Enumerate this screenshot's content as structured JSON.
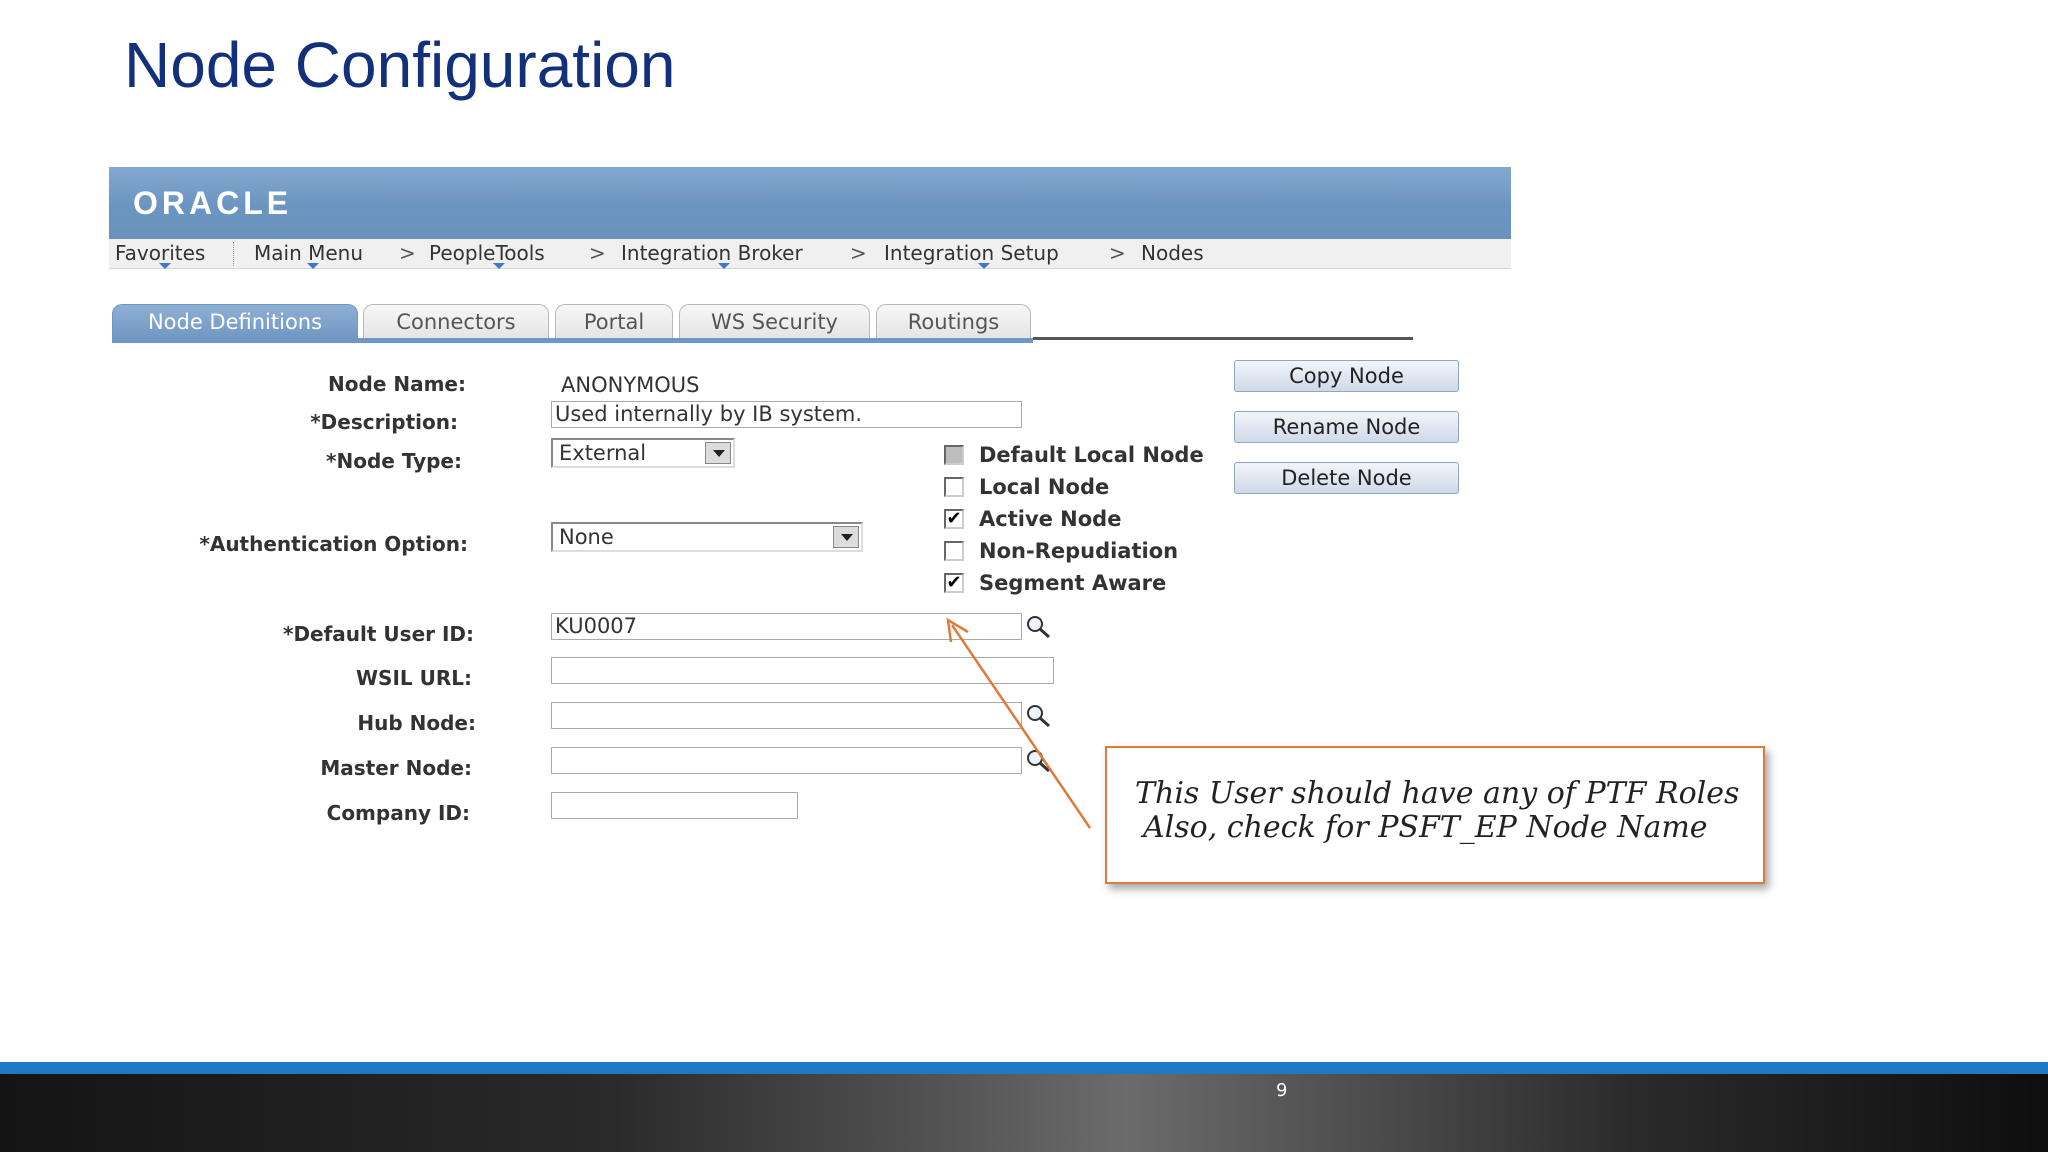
{
  "slide": {
    "title": "Node Configuration",
    "page_number": "9"
  },
  "oracle": {
    "logo": "ORACLE"
  },
  "breadcrumb": [
    {
      "label": "Favorites"
    },
    {
      "label": "Main Menu"
    },
    {
      "label": "PeopleTools"
    },
    {
      "label": "Integration Broker"
    },
    {
      "label": "Integration Setup"
    },
    {
      "label": "Nodes"
    }
  ],
  "breadcrumb_separator": ">",
  "tabs": [
    {
      "label": "Node Definitions",
      "active": true
    },
    {
      "label": "Connectors"
    },
    {
      "label": "Portal"
    },
    {
      "label": "WS Security"
    },
    {
      "label": "Routings"
    }
  ],
  "form": {
    "node_name": {
      "label": "Node Name:",
      "value": "ANONYMOUS"
    },
    "description": {
      "label": "*Description:",
      "value": "Used internally by IB system."
    },
    "node_type": {
      "label": "*Node Type:",
      "value": "External"
    },
    "authentication_option": {
      "label": "*Authentication Option:",
      "value": "None"
    },
    "default_user_id": {
      "label": "*Default User ID:",
      "value": "KU0007"
    },
    "wsil_url": {
      "label": "WSIL URL:",
      "value": ""
    },
    "hub_node": {
      "label": "Hub Node:",
      "value": ""
    },
    "master_node": {
      "label": "Master Node:",
      "value": ""
    },
    "company_id": {
      "label": "Company ID:",
      "value": ""
    }
  },
  "checkboxes": [
    {
      "label": "Default Local Node",
      "checked": false,
      "disabled": true
    },
    {
      "label": "Local Node",
      "checked": false
    },
    {
      "label": "Active Node",
      "checked": true
    },
    {
      "label": "Non-Repudiation",
      "checked": false
    },
    {
      "label": "Segment Aware",
      "checked": true
    }
  ],
  "buttons": {
    "copy": "Copy Node",
    "rename": "Rename Node",
    "delete": "Delete Node"
  },
  "callout": {
    "line1": "This User should have any of PTF Roles",
    "line2": "Also, check for PSFT_EP Node Name",
    "border_color": "#e07a3a"
  },
  "colors": {
    "title": "#12317a",
    "banner": "#6b94c0",
    "footer_accent": "#1e78c4"
  },
  "icons": {
    "lookup": "magnifier-icon",
    "check": "checkmark-icon"
  }
}
